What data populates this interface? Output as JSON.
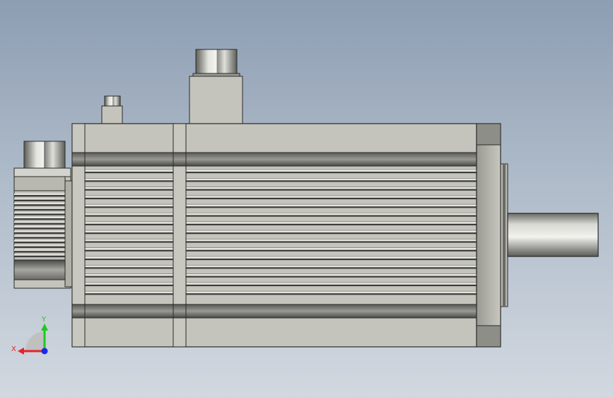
{
  "viewport": {
    "background_top": "#8d9db2",
    "background_bottom": "#d2d8e0"
  },
  "model": {
    "body_color": "#c4c4bc",
    "edge_color": "#2a2a2a",
    "fin_dark": "#3c3c3c",
    "fin_light": "#e6e6e0"
  },
  "triad": {
    "x_label": "X",
    "y_label": "Y",
    "x_color": "#e8202a",
    "y_color": "#1ec81e",
    "z_color": "#1a2ae8"
  }
}
